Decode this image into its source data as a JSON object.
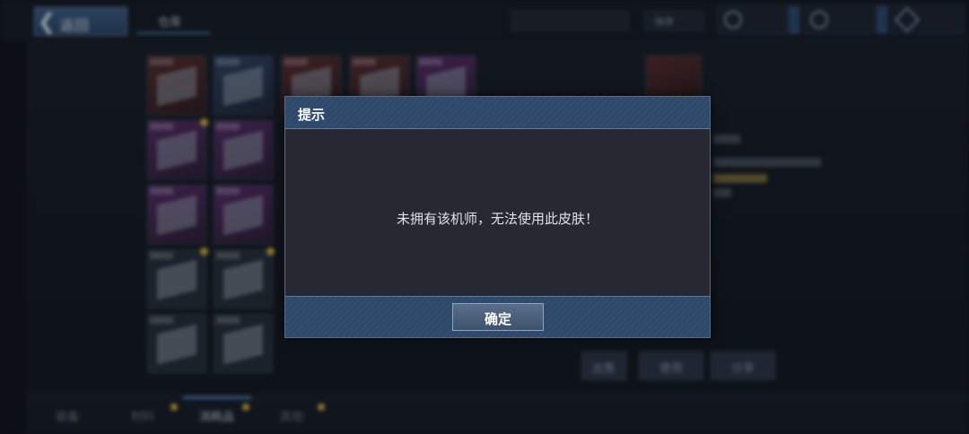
{
  "header": {
    "back_label": "返回",
    "tab_label": "仓库",
    "filter_label": "排序",
    "search_label": ""
  },
  "bottom_tabs": [
    {
      "label": "装备"
    },
    {
      "label": "材料"
    },
    {
      "label": "消耗品"
    },
    {
      "label": "其他"
    }
  ],
  "actions": [
    {
      "label": "出售"
    },
    {
      "label": "使用"
    },
    {
      "label": "分享"
    }
  ],
  "dialog": {
    "title": "提示",
    "message": "未拥有该机师，无法使用此皮肤！",
    "confirm_label": "确定"
  },
  "colors": {
    "accent": "#4a8bc4",
    "dialog_header": "#324f72",
    "badge": "#d8b13b"
  }
}
